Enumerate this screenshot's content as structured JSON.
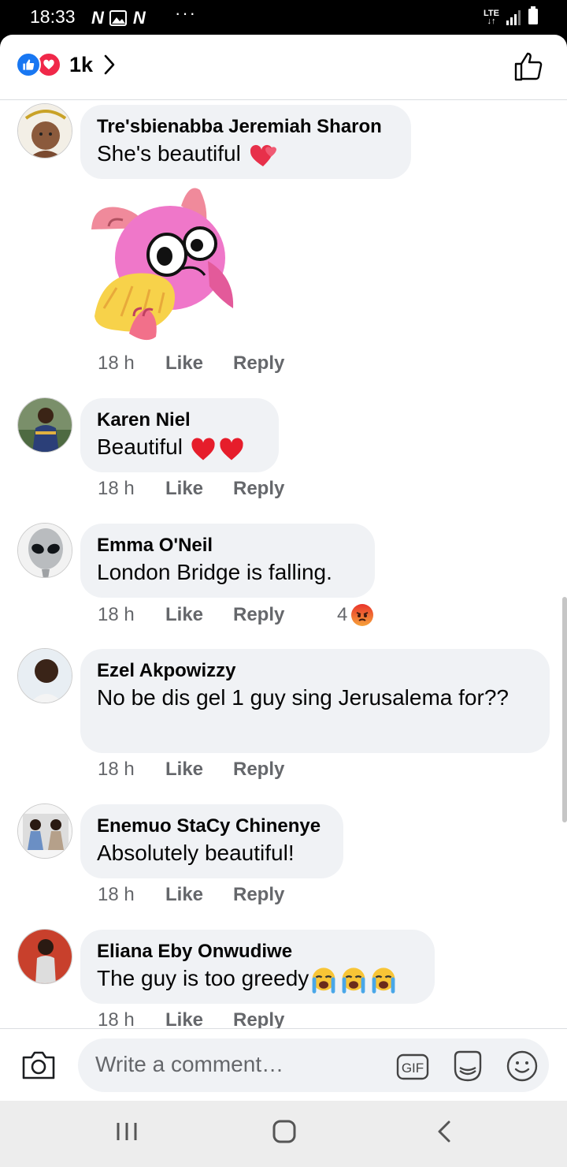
{
  "status": {
    "time": "18:33",
    "network": "LTE"
  },
  "header": {
    "reaction_count": "1k"
  },
  "comments": [
    {
      "name": "Tre'sbienabba Jeremiah Sharon",
      "text": "She's beautiful",
      "time": "18 h",
      "like": "Like",
      "reply": "Reply"
    },
    {
      "name": "Karen Niel",
      "text": "Beautiful",
      "time": "18 h",
      "like": "Like",
      "reply": "Reply"
    },
    {
      "name": "Emma O'Neil",
      "text": "London Bridge is falling.",
      "time": "18 h",
      "like": "Like",
      "reply": "Reply",
      "reaction_count": "4"
    },
    {
      "name": "Ezel Akpowizzy",
      "text": "No be dis gel 1 guy sing Jerusalema for??",
      "time": "18 h",
      "like": "Like",
      "reply": "Reply"
    },
    {
      "name": "Enemuo StaCy Chinenye",
      "text": "Absolutely beautiful!",
      "time": "18 h",
      "like": "Like",
      "reply": "Reply"
    },
    {
      "name": "Eliana Eby Onwudiwe",
      "text": "The guy is too greedy",
      "time": "18 h",
      "like": "Like",
      "reply": "Reply"
    }
  ],
  "composer": {
    "placeholder": "Write a comment…"
  },
  "icons": {
    "like": "like-icon",
    "love": "love-icon",
    "chevron": "chevron-right-icon",
    "camera": "camera-icon",
    "gif": "gif-icon",
    "sticker": "sticker-icon",
    "emoji": "emoji-icon",
    "nav_recents": "recents-icon",
    "nav_home": "home-icon",
    "nav_back": "back-icon"
  },
  "colors": {
    "accent": "#1877f2",
    "love": "#f02849",
    "meta": "#65676b",
    "bubble": "#f0f2f5"
  }
}
